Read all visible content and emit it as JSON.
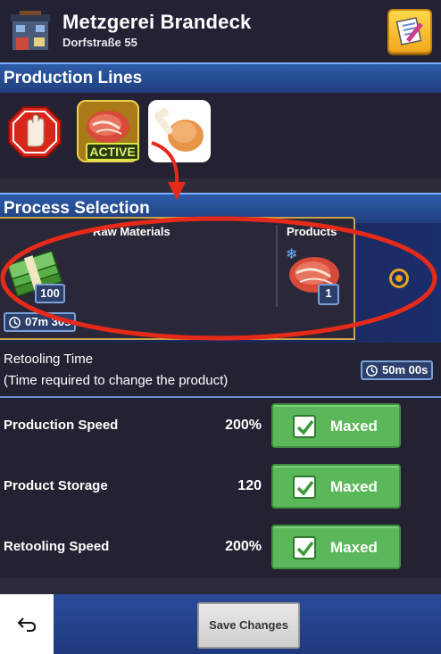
{
  "header": {
    "title": "Metzgerei Brandeck",
    "subtitle": "Dorfstraße 55",
    "building_icon": "building-icon",
    "notes_icon": "notepad-pencil-icon"
  },
  "production_lines": {
    "title": "Production Lines",
    "items": [
      {
        "icon": "stop-hand-icon",
        "active": false
      },
      {
        "icon": "raw-meat-icon",
        "active": true,
        "tag": "ACTIVE"
      },
      {
        "icon": "chicken-leg-icon",
        "active": false
      }
    ]
  },
  "process_selection": {
    "title": "Process Selection",
    "raw_materials_label": "Raw Materials",
    "products_label": "Products",
    "raw_quantity": "100",
    "product_quantity": "1",
    "process_time": "07m 30s",
    "raw_icon": "cash-stack-icon",
    "product_icon": "frozen-meat-icon"
  },
  "retooling": {
    "line1": "Retooling Time",
    "line2": "(Time required to change the product)",
    "time": "50m 00s"
  },
  "stats": [
    {
      "label": "Production Speed",
      "value": "200%",
      "button": "Maxed"
    },
    {
      "label": "Product Storage",
      "value": "120",
      "button": "Maxed"
    },
    {
      "label": "Retooling Speed",
      "value": "200%",
      "button": "Maxed"
    }
  ],
  "footer": {
    "save_label": "Save Changes",
    "back_icon": "back-arrow-icon"
  },
  "colors": {
    "accent_blue": "#2d5ca8",
    "maxed_green": "#5ab85a",
    "annotation_red": "#e52a1a",
    "active_yellow": "#d8e84a"
  }
}
